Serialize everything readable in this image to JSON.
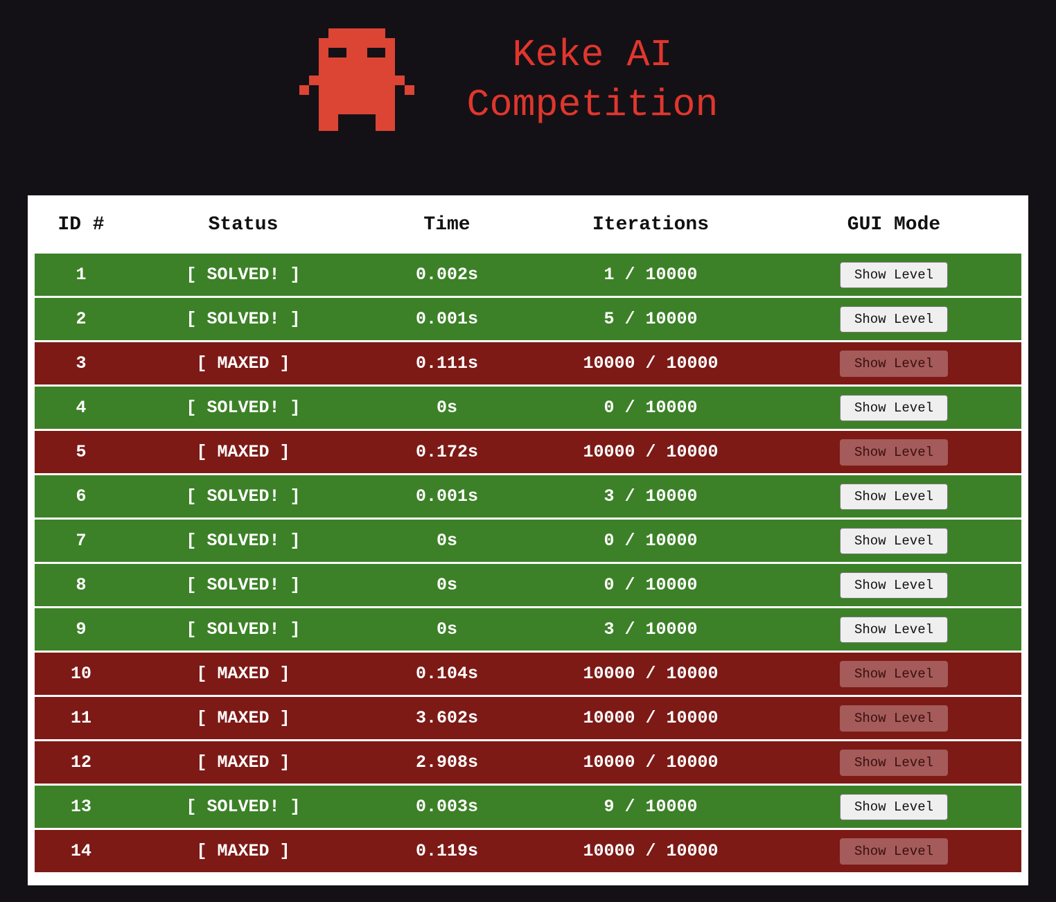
{
  "header": {
    "title_line1": "Keke AI",
    "title_line2": "Competition",
    "logo_icon": "keke-pixel-creature-icon",
    "logo_color": "#dc4434"
  },
  "colors": {
    "background": "#141116",
    "title": "#e1362d",
    "solved_row": "#3c8127",
    "maxed_row": "#7d1a16"
  },
  "table": {
    "columns": [
      "ID #",
      "Status",
      "Time",
      "Iterations",
      "GUI Mode"
    ],
    "button_label": "Show Level",
    "rows": [
      {
        "id": "1",
        "status": "[ SOLVED! ]",
        "state": "solved",
        "time": "0.002s",
        "iterations": "1 / 10000"
      },
      {
        "id": "2",
        "status": "[ SOLVED! ]",
        "state": "solved",
        "time": "0.001s",
        "iterations": "5 / 10000"
      },
      {
        "id": "3",
        "status": "[ MAXED ]",
        "state": "maxed",
        "time": "0.111s",
        "iterations": "10000 / 10000"
      },
      {
        "id": "4",
        "status": "[ SOLVED! ]",
        "state": "solved",
        "time": "0s",
        "iterations": "0 / 10000"
      },
      {
        "id": "5",
        "status": "[ MAXED ]",
        "state": "maxed",
        "time": "0.172s",
        "iterations": "10000 / 10000"
      },
      {
        "id": "6",
        "status": "[ SOLVED! ]",
        "state": "solved",
        "time": "0.001s",
        "iterations": "3 / 10000"
      },
      {
        "id": "7",
        "status": "[ SOLVED! ]",
        "state": "solved",
        "time": "0s",
        "iterations": "0 / 10000"
      },
      {
        "id": "8",
        "status": "[ SOLVED! ]",
        "state": "solved",
        "time": "0s",
        "iterations": "0 / 10000"
      },
      {
        "id": "9",
        "status": "[ SOLVED! ]",
        "state": "solved",
        "time": "0s",
        "iterations": "3 / 10000"
      },
      {
        "id": "10",
        "status": "[ MAXED ]",
        "state": "maxed",
        "time": "0.104s",
        "iterations": "10000 / 10000"
      },
      {
        "id": "11",
        "status": "[ MAXED ]",
        "state": "maxed",
        "time": "3.602s",
        "iterations": "10000 / 10000"
      },
      {
        "id": "12",
        "status": "[ MAXED ]",
        "state": "maxed",
        "time": "2.908s",
        "iterations": "10000 / 10000"
      },
      {
        "id": "13",
        "status": "[ SOLVED! ]",
        "state": "solved",
        "time": "0.003s",
        "iterations": "9 / 10000"
      },
      {
        "id": "14",
        "status": "[ MAXED ]",
        "state": "maxed",
        "time": "0.119s",
        "iterations": "10000 / 10000"
      }
    ]
  }
}
